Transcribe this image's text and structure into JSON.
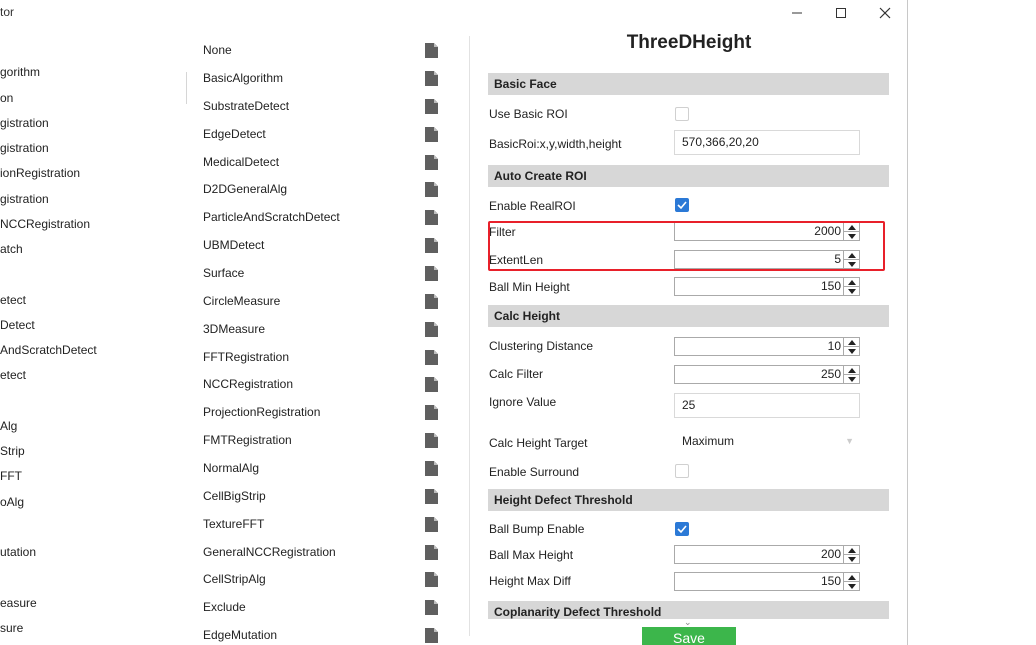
{
  "window": {
    "title": "tor"
  },
  "tree": {
    "items": [
      "gorithm",
      "on",
      "gistration",
      "gistration",
      "ionRegistration",
      "gistration",
      "NCCRegistration",
      "atch",
      "etect",
      "Detect",
      "AndScratchDetect",
      "etect",
      "Alg",
      "Strip",
      "FFT",
      "oAlg",
      "utation",
      "easure",
      "sure"
    ]
  },
  "algorithms": {
    "items": [
      "None",
      "BasicAlgorithm",
      "SubstrateDetect",
      "EdgeDetect",
      "MedicalDetect",
      "D2DGeneralAlg",
      "ParticleAndScratchDetect",
      "UBMDetect",
      "Surface",
      "CircleMeasure",
      "3DMeasure",
      "FFTRegistration",
      "NCCRegistration",
      "ProjectionRegistration",
      "FMTRegistration",
      "NormalAlg",
      "CellBigStrip",
      "TextureFFT",
      "GeneralNCCRegistration",
      "CellStripAlg",
      "Exclude",
      "EdgeMutation"
    ]
  },
  "panel": {
    "title": "ThreeDHeight",
    "sections": {
      "basic_face": "Basic Face",
      "auto_create_roi": "Auto Create ROI",
      "calc_height": "Calc Height",
      "height_defect": "Height Defect Threshold",
      "coplanarity": "Coplanarity Defect Threshold"
    },
    "fields": {
      "use_basic_roi": {
        "label": "Use Basic ROI",
        "checked": false
      },
      "basic_roi": {
        "label": "BasicRoi:x,y,width,height",
        "value": "570,366,20,20"
      },
      "enable_realroi": {
        "label": "Enable RealROI",
        "checked": true
      },
      "filter": {
        "label": "Filter",
        "value": "2000"
      },
      "extentlen": {
        "label": "ExtentLen",
        "value": "5"
      },
      "ball_min_height": {
        "label": "Ball Min Height",
        "value": "150"
      },
      "clustering_distance": {
        "label": "Clustering Distance",
        "value": "10"
      },
      "calc_filter": {
        "label": "Calc Filter",
        "value": "250"
      },
      "ignore_value": {
        "label": "Ignore Value",
        "value": "25"
      },
      "calc_height_target": {
        "label": "Calc Height Target",
        "value": "Maximum"
      },
      "enable_surround": {
        "label": "Enable Surround",
        "checked": false
      },
      "ball_bump_enable": {
        "label": "Ball Bump Enable",
        "checked": true
      },
      "ball_max_height": {
        "label": "Ball Max Height",
        "value": "200"
      },
      "height_max_diff": {
        "label": "Height Max Diff",
        "value": "150"
      }
    },
    "save_label": "Save"
  },
  "colors": {
    "accent": "#2b79d6",
    "save": "#3cb64b",
    "highlight": "#e8202a",
    "section": "#d7d7d7"
  }
}
